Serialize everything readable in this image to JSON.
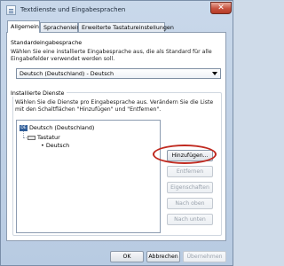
{
  "window": {
    "title": "Textdienste und Eingabesprachen",
    "close_glyph": "✕"
  },
  "tabs": [
    {
      "label": "Allgemein"
    },
    {
      "label": "Sprachenleiste"
    },
    {
      "label": "Erweiterte Tastatureinstellungen"
    }
  ],
  "default_language": {
    "heading": "Standardeingabesprache",
    "description_line1": "Wählen Sie eine installierte Eingabesprache aus, die als Standard für alle",
    "description_line2": "Eingabefelder verwendet werden soll.",
    "selected": "Deutsch (Deutschland) - Deutsch"
  },
  "installed_services": {
    "heading": "Installierte Dienste",
    "description_line1": "Wählen Sie die Dienste pro Eingabesprache aus. Verändern Sie die Liste",
    "description_line2": "mit den Schaltflächen \"Hinzufügen\" und \"Entfernen\".",
    "tree": {
      "language_badge": "DE",
      "language": "Deutsch (Deutschland)",
      "category": "Tastatur",
      "bullet": "•",
      "layout": "Deutsch"
    },
    "buttons": {
      "add": "Hinzufügen...",
      "remove": "Entfernen",
      "properties": "Eigenschaften",
      "move_down": "Nach oben",
      "move_up": "Nach unten"
    }
  },
  "footer": {
    "ok": "OK",
    "cancel": "Abbrechen",
    "apply": "Übernehmen"
  },
  "colors": {
    "highlight_ring": "#c0291f",
    "close_button": "#c7523f",
    "window_frame": "#c9d8ea"
  }
}
